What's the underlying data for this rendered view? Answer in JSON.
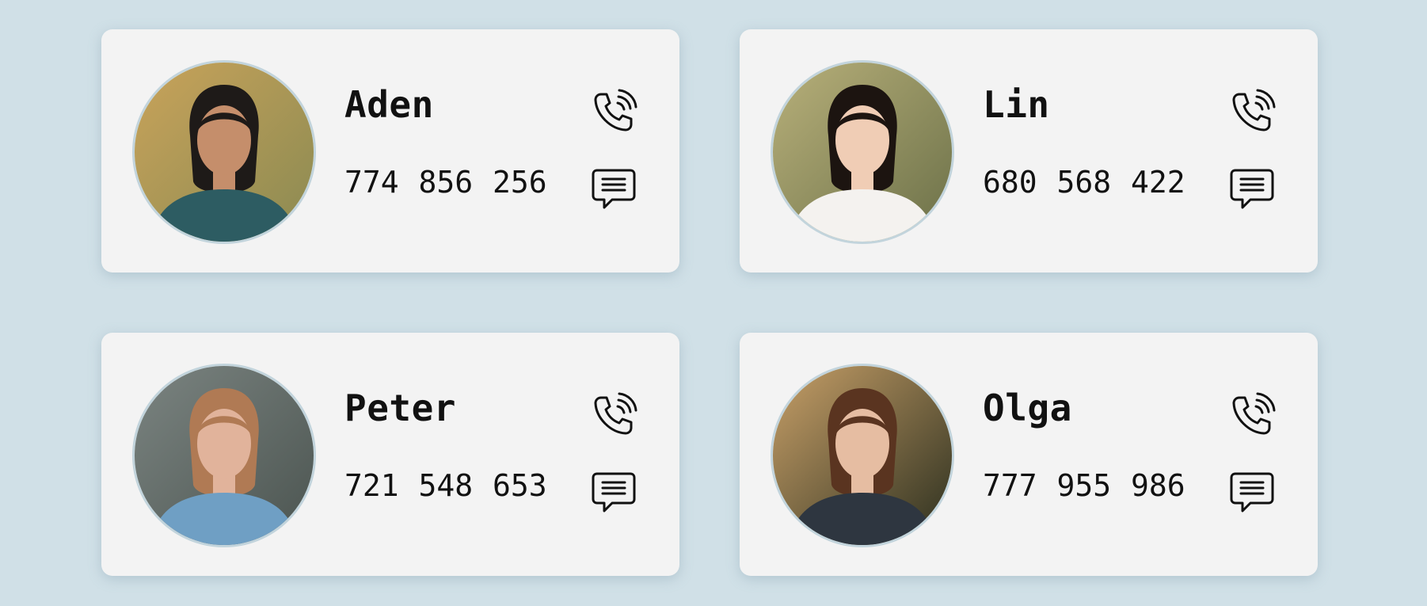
{
  "contacts": [
    {
      "name": "Aden",
      "phone": "774 856 256",
      "avatar": {
        "bg": "#8a8a52",
        "bg2": "#c9a35a",
        "skin": "#c58e6b",
        "hair": "#1e1a18",
        "shirt": "#2d5c62"
      }
    },
    {
      "name": "Lin",
      "phone": "680 568 422",
      "avatar": {
        "bg": "#6b7048",
        "bg2": "#b8b07a",
        "skin": "#f0cdb5",
        "hair": "#1c1410",
        "shirt": "#f4f2ef"
      }
    },
    {
      "name": "Peter",
      "phone": "721 548 653",
      "avatar": {
        "bg": "#4b5450",
        "bg2": "#7b8481",
        "skin": "#e1b39b",
        "hair": "#b07a54",
        "shirt": "#6f9fc4"
      }
    },
    {
      "name": "Olga",
      "phone": "777 955 986",
      "avatar": {
        "bg": "#2a2e1e",
        "bg2": "#c8a068",
        "skin": "#e6bda2",
        "hair": "#5a3420",
        "shirt": "#2e3640"
      }
    }
  ],
  "icons": {
    "call": "phone-call-icon",
    "message": "chat-message-icon"
  }
}
